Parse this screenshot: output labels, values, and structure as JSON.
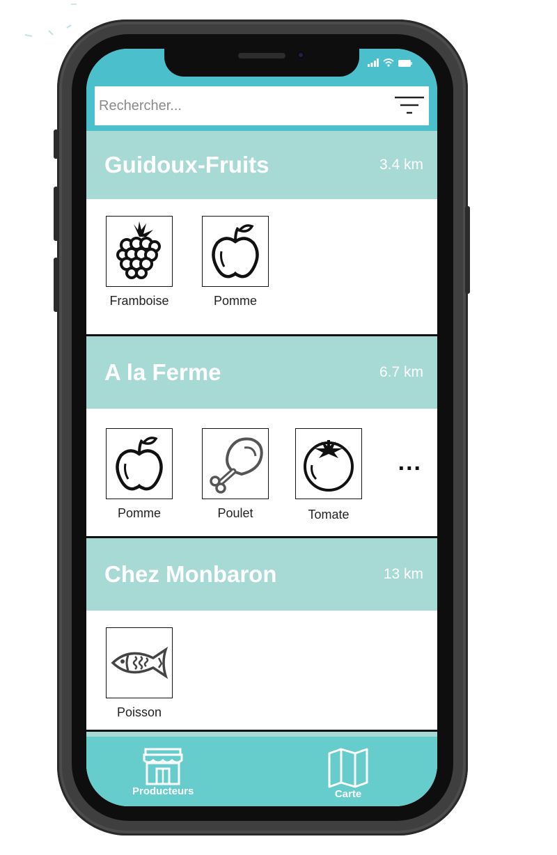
{
  "search": {
    "placeholder": "Rechercher..."
  },
  "producers": [
    {
      "name": "Guidoux-Fruits",
      "distance": "3.4 km",
      "products": [
        {
          "label": "Framboise",
          "icon": "raspberry-icon"
        },
        {
          "label": "Pomme",
          "icon": "apple-icon"
        }
      ]
    },
    {
      "name": "A la Ferme",
      "distance": "6.7 km",
      "more": "...",
      "products": [
        {
          "label": "Pomme",
          "icon": "apple-icon"
        },
        {
          "label": "Poulet",
          "icon": "chicken-leg-icon"
        },
        {
          "label": "Tomate",
          "icon": "tomato-icon"
        }
      ]
    },
    {
      "name": "Chez Monbaron",
      "distance": "13 km",
      "products": [
        {
          "label": "Poisson",
          "icon": "fish-icon"
        }
      ]
    }
  ],
  "tabs": [
    {
      "label": "Producteurs",
      "icon": "shop-icon"
    },
    {
      "label": "Carte",
      "icon": "map-icon"
    }
  ],
  "colors": {
    "header_teal": "#4bbfcc",
    "card_header": "#a7dad5",
    "tabbar": "#66cccc"
  }
}
